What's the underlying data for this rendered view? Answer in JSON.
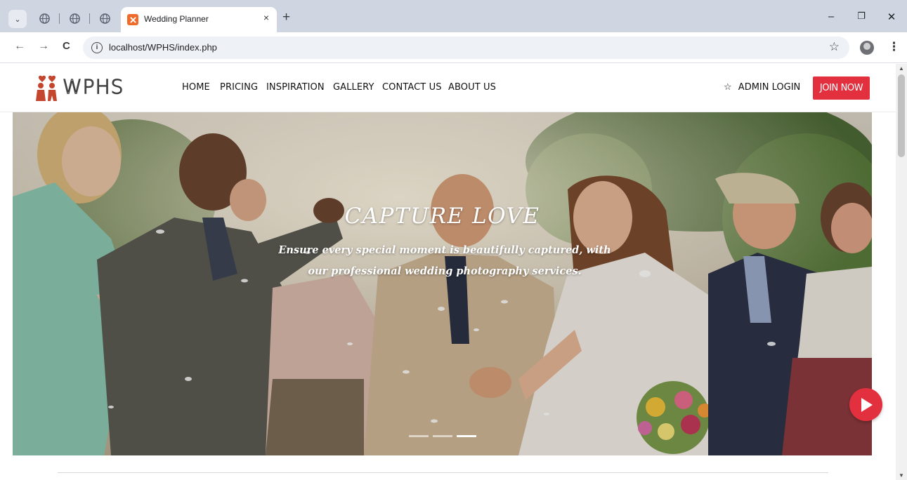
{
  "browser": {
    "tab_title": "Wedding Planner",
    "url": "localhost/WPHS/index.php",
    "new_tab_symbol": "+",
    "tab_close_symbol": "×",
    "window_controls": {
      "minimize": "–",
      "restore": "❐",
      "close": "✕"
    },
    "nav": {
      "back": "←",
      "forward": "→",
      "reload": "C",
      "info": "i",
      "bookmark": "☆",
      "menu": "⋮"
    }
  },
  "site": {
    "logo_text": "WPHS",
    "nav_items": [
      "HOME",
      "PRICING",
      "INSPIRATION",
      "GALLERY",
      "CONTACT US",
      "ABOUT US"
    ],
    "admin_login": "ADMIN LOGIN",
    "admin_icon": "☆",
    "join_button": "JOIN NOW"
  },
  "hero": {
    "title": "CAPTURE LOVE",
    "subtitle": "Ensure every special moment is beautifully captured, with our professional wedding photography services.",
    "slides": 3,
    "active_slide": 3
  },
  "colors": {
    "accent": "#e3303f",
    "tabbar": "#cfd6e2"
  },
  "icons": [
    "chevron-down-icon",
    "globe-icon",
    "star-icon",
    "play-icon",
    "logo-couple-icon"
  ]
}
